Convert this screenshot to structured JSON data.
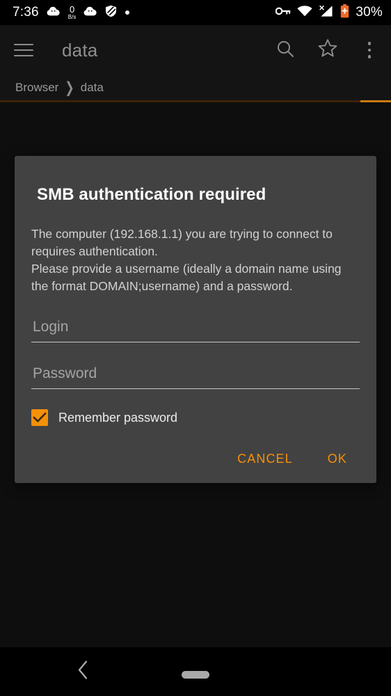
{
  "status_bar": {
    "time": "7:36",
    "network_speed_value": "0",
    "network_speed_unit": "B/s",
    "battery_percent": "30%",
    "icons": [
      "cloud-icon",
      "network-speed-icon",
      "cloud-icon",
      "shield-icon",
      "dot-icon",
      "vpn-key-icon",
      "wifi-icon",
      "cell-signal-no-sim-icon",
      "battery-icon"
    ]
  },
  "app_bar": {
    "title": "data",
    "menu_label": "Menu",
    "search_label": "Search",
    "bookmark_label": "Bookmark",
    "overflow_label": "More options"
  },
  "breadcrumb": {
    "root": "Browser",
    "separator": "❯",
    "current": "data"
  },
  "progress": {
    "color_track": "#3d2307",
    "color_fill": "#cc7a11"
  },
  "dialog": {
    "title": "SMB authentication required",
    "body": "The computer (192.168.1.1) you are trying to connect to requires authentication.\nPlease provide a username (ideally a domain name using the format DOMAIN;username) and a password.",
    "login": {
      "placeholder": "Login",
      "value": ""
    },
    "password": {
      "placeholder": "Password",
      "value": ""
    },
    "remember": {
      "label": "Remember password",
      "checked": true
    },
    "cancel_label": "CANCEL",
    "ok_label": "OK",
    "accent_color": "#f59008",
    "background_color": "#424242"
  },
  "nav_bar": {
    "back_label": "Back",
    "home_label": "Home"
  }
}
